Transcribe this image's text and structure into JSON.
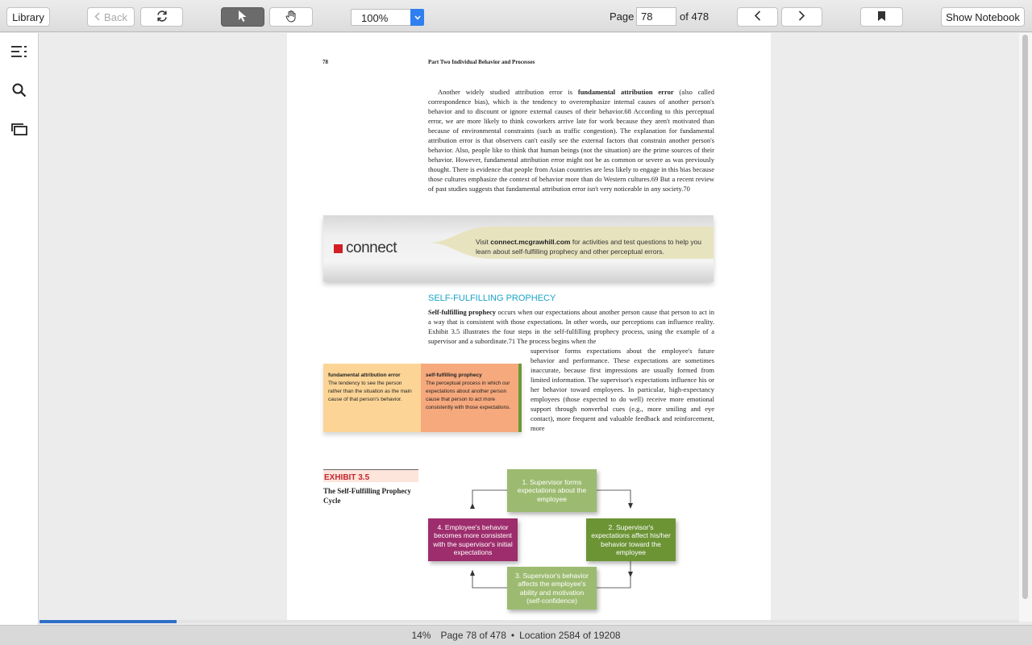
{
  "toolbar": {
    "library_label": "Library",
    "back_label": "Back",
    "zoom_value": "100%",
    "page_label": "Page",
    "page_number": "78",
    "page_total_label": "of 478",
    "show_notebook_label": "Show Notebook"
  },
  "icons": {
    "sync": "sync-icon",
    "select": "arrow-pointer-icon",
    "pan": "hand-icon",
    "prev": "chevron-left-icon",
    "next": "chevron-right-icon",
    "bookmark": "bookmark-icon",
    "toc": "table-of-contents-icon",
    "search": "search-icon",
    "cards": "flashcards-icon"
  },
  "page": {
    "number": "78",
    "part_header": "Part Two   Individual Behavior and Processes",
    "para1_lead": "Another widely studied attribution error is ",
    "para1_term": "fundamental attribution error",
    "para1_body": " (also called correspondence bias), which is the tendency to overemphasize internal causes of another person's behavior and to discount or ignore external causes of their behavior.68 According to this perceptual error, we are more likely to think coworkers arrive late for work because they aren't motivated than because of environmental constraints (such as traffic congestion). The explanation for fundamental attribution error is that observers can't easily see the external factors that constrain another person's behavior. Also, people like to think that human beings (not the situation) are the prime sources of their behavior. However, fundamental attribution error might not be as common or severe as was previously thought. There is evidence that people from Asian countries are less likely to engage in this bias because those cultures emphasize the context of behavior more than do Western cultures.69 But a recent review of past studies suggests that fundamental attribution error isn't very noticeable in any society.70",
    "connect_word": "connect",
    "connect_text_pre": "Visit ",
    "connect_url": "connect.mcgrawhill.com",
    "connect_text_post": " for activities and test questions to help you learn about self-fulfilling prophecy and other perceptual errors.",
    "section_title": "SELF-FULFILLING PROPHECY",
    "para2_term": "Self-fulfilling prophecy",
    "para2_body": " occurs when our expectations about another person cause that person to act in a way that is consistent with those expectations. In other words, our perceptions can influence reality. Exhibit 3.5 illustrates the four steps in the self-fulfilling prophecy process, using the example of a supervisor and a subordinate.71 The process begins when the",
    "para3": "supervisor forms expectations about the employee's future behavior and performance. These expectations are sometimes inaccurate, because first impressions are usually formed from limited information. The supervisor's expectations influence his or her behavior toward employees. In particular, high-expectancy employees (those expected to do well) receive more emotional support through nonverbal cues (e.g., more smiling and eye contact), more frequent and valuable feedback and reinforcement, more",
    "glossary": [
      {
        "term": "fundamental attribution error",
        "definition": "The tendency to see the person rather than the situation as the main cause of that person's behavior."
      },
      {
        "term": "self-fulfilling prophecy",
        "definition": "The perceptual process in which our expectations about another person cause that person to act more consistently with those expectations."
      }
    ],
    "exhibit_label": "EXHIBIT 3.5",
    "exhibit_title": "The Self-Fulfilling Prophecy Cycle",
    "flow": [
      "1. Supervisor forms expectations about the employee",
      "2. Supervisor's expectations affect his/her behavior toward the employee",
      "3. Supervisor's behavior affects the employee's ability and motivation (self-confidence)",
      "4. Employee's behavior becomes more consistent with the supervisor's initial expectations"
    ]
  },
  "status": {
    "percent": "14%",
    "page_info": "Page 78 of 478",
    "separator": "•",
    "location": "Location 2584 of 19208",
    "progress_fraction": 0.14
  }
}
